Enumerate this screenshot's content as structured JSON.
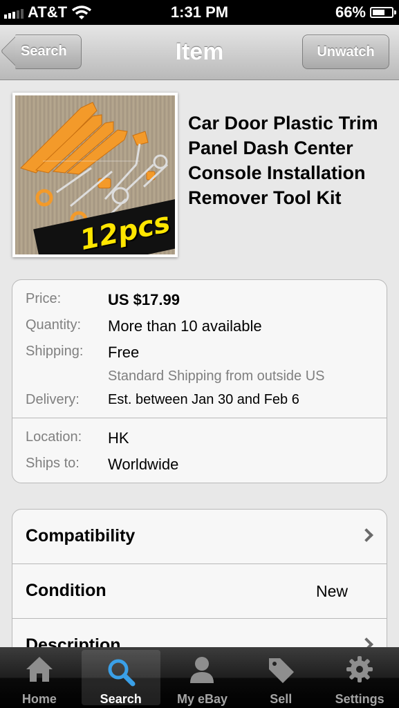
{
  "status_bar": {
    "carrier": "AT&T",
    "time": "1:31 PM",
    "battery": "66%",
    "battery_level": 0.66
  },
  "nav": {
    "back_label": "Search",
    "title": "Item",
    "right_label": "Unwatch"
  },
  "product": {
    "title": "Car Door Plastic Trim Panel Dash Center Console Installation Remover Tool Kit",
    "image_label": "12pcs"
  },
  "details": {
    "price_label": "Price:",
    "price_value": "US $17.99",
    "quantity_label": "Quantity:",
    "quantity_value": "More than 10 available",
    "shipping_label": "Shipping:",
    "shipping_value": "Free",
    "shipping_note": "Standard Shipping from outside US",
    "delivery_label": "Delivery:",
    "delivery_value": "Est. between Jan 30 and Feb 6",
    "location_label": "Location:",
    "location_value": "HK",
    "ships_to_label": "Ships to:",
    "ships_to_value": "Worldwide"
  },
  "info_rows": {
    "compatibility": "Compatibility",
    "condition": "Condition",
    "condition_value": "New",
    "description": "Description"
  },
  "tabs": {
    "home": "Home",
    "search": "Search",
    "my_ebay": "My eBay",
    "sell": "Sell",
    "settings": "Settings",
    "active": "search"
  },
  "colors": {
    "tool_orange": "#f39a2a",
    "promo_yellow": "#ffe600",
    "search_icon_blue": "#3aa0e8"
  }
}
